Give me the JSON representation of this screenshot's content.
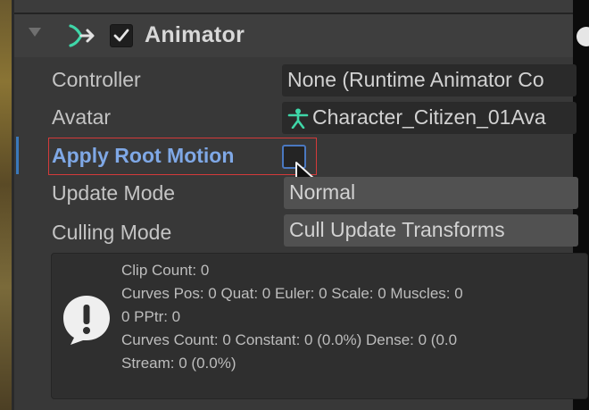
{
  "component": {
    "title": "Animator",
    "enabled": true
  },
  "properties": {
    "controller": {
      "label": "Controller",
      "value": "None (Runtime Animator Co"
    },
    "avatar": {
      "label": "Avatar",
      "value": "Character_Citizen_01Ava"
    },
    "apply_root_motion": {
      "label": "Apply Root Motion",
      "checked": false
    },
    "update_mode": {
      "label": "Update Mode",
      "value": "Normal"
    },
    "culling_mode": {
      "label": "Culling Mode",
      "value": "Cull Update Transforms"
    }
  },
  "info": {
    "lines": [
      "Clip Count: 0",
      "Curves Pos: 0 Quat: 0 Euler: 0 Scale: 0 Muscles: 0",
      "0 PPtr: 0",
      "Curves Count: 0 Constant: 0 (0.0%) Dense: 0 (0.0",
      "Stream: 0 (0.0%)"
    ]
  },
  "colors": {
    "accent_label": "#7fa8e6",
    "highlight_border": "#d43a3a",
    "avatar_icon": "#3fd6a8",
    "animator_icon": "#3fd6a8"
  },
  "icons": {
    "foldout": "chevron-down-icon",
    "component": "animator-icon",
    "avatar": "humanoid-avatar-icon",
    "info": "exclamation-speech-bubble-icon",
    "cursor": "mouse-pointer-icon",
    "help": "help-icon"
  }
}
